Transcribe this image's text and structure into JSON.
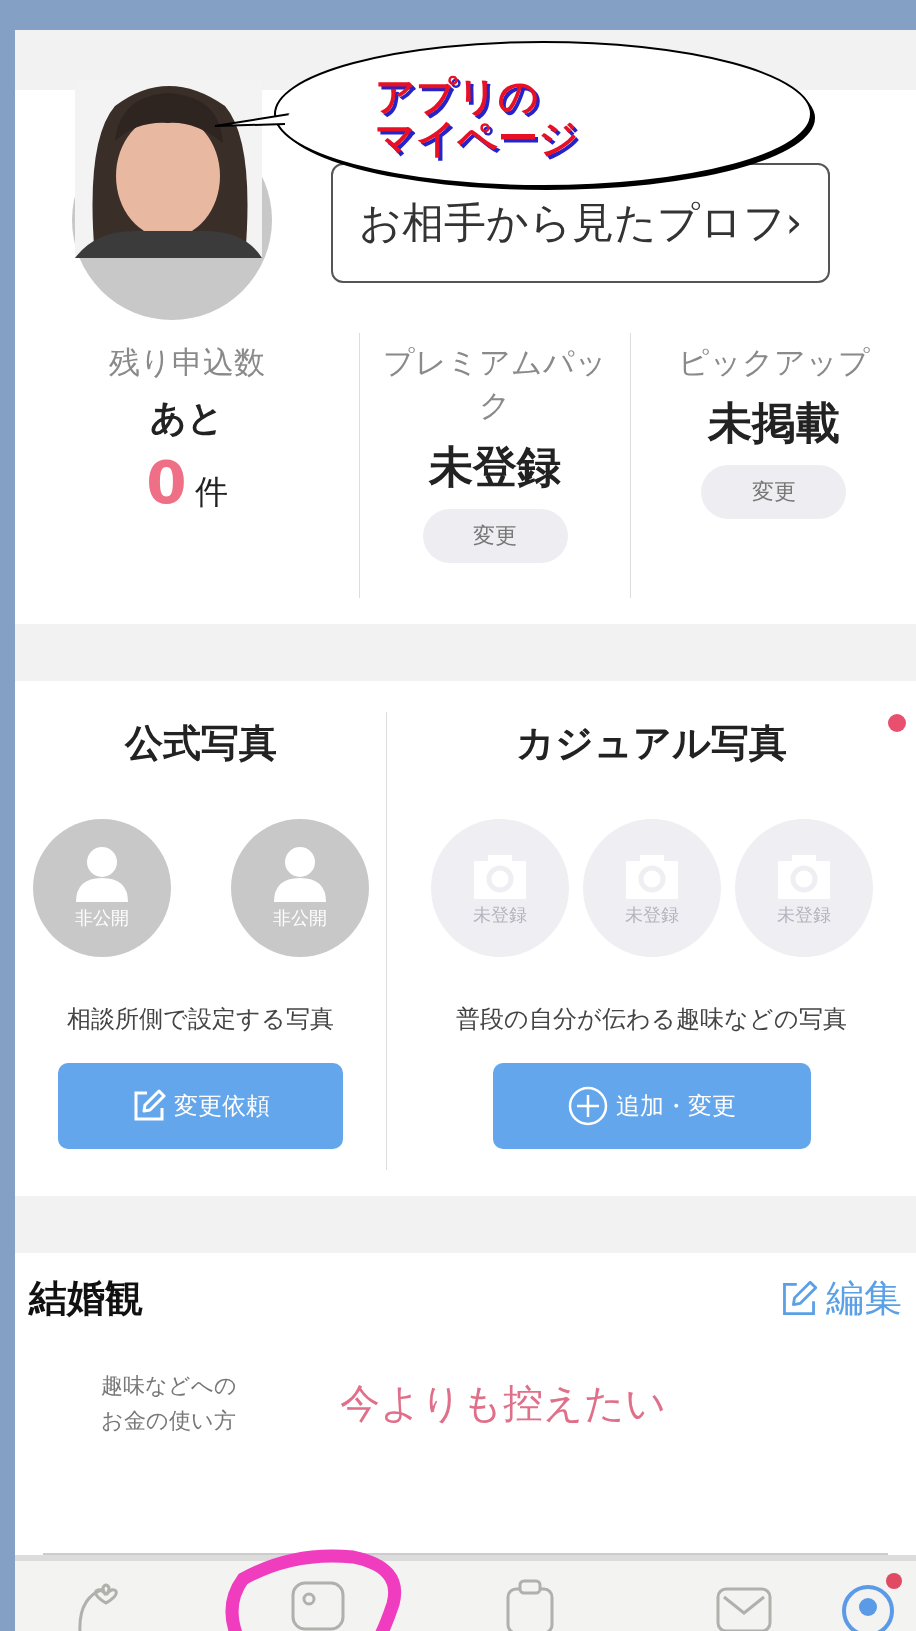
{
  "annotations": {
    "bubble_lines": [
      "アプリの",
      "マイページ"
    ],
    "photo": {
      "kind": "picture"
    }
  },
  "profile": {
    "view_button": "お相手から見たプロフ›"
  },
  "stats": [
    {
      "kind": "count",
      "label": "残り申込数",
      "prefix": "あと",
      "count": "0",
      "unit": "件"
    },
    {
      "kind": "status",
      "label": "プレミアムパック",
      "value": "未登録",
      "button": "変更"
    },
    {
      "kind": "status",
      "label": "ピックアップ",
      "value": "未掲載",
      "button": "変更"
    }
  ],
  "photos": [
    {
      "title": "公式写真",
      "slots": [
        {
          "kind": "person",
          "label": "非公開"
        },
        {
          "kind": "person",
          "label": "非公開"
        }
      ],
      "description": "相談所側で設定する写真",
      "button": "変更依頼"
    },
    {
      "title": "カジュアル写真",
      "notice": true,
      "slots": [
        {
          "kind": "camera",
          "label": "未登録"
        },
        {
          "kind": "camera",
          "label": "未登録"
        },
        {
          "kind": "camera",
          "label": "未登録"
        }
      ],
      "description": "普段の自分が伝わる趣味などの写真",
      "button": "追加・変更"
    }
  ],
  "marriage_views": {
    "title": "結婚観",
    "edit": "編集",
    "items": [
      {
        "label": "趣味などへのお金の使い方",
        "value": "今よりも控えたい"
      }
    ]
  },
  "tab_bar": [
    {
      "selected": false
    },
    {
      "selected": false
    },
    {
      "selected": false
    },
    {
      "selected": false
    },
    {
      "selected": true,
      "badge": true
    }
  ]
}
